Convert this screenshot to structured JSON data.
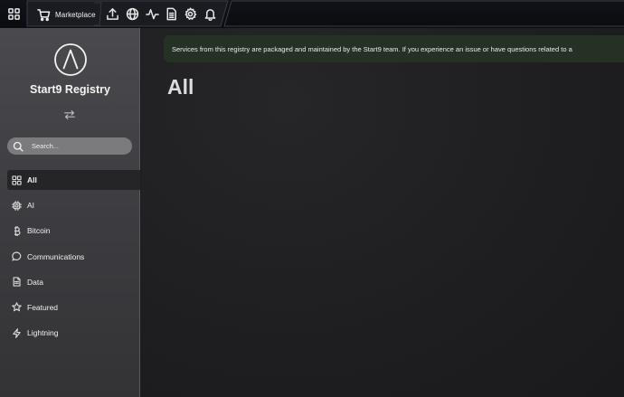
{
  "topbar": {
    "tab_label": "Marketplace",
    "icons": [
      "apps-grid-icon",
      "cart-icon",
      "upload-icon",
      "globe-icon",
      "activity-icon",
      "document-icon",
      "gear-icon",
      "bell-icon"
    ]
  },
  "sidebar": {
    "brand": "Start9 Registry",
    "search_placeholder": "Search...",
    "items": [
      {
        "label": "All",
        "icon": "grid-icon",
        "active": true
      },
      {
        "label": "AI",
        "icon": "chip-icon",
        "active": false
      },
      {
        "label": "Bitcoin",
        "icon": "bitcoin-icon",
        "active": false
      },
      {
        "label": "Communications",
        "icon": "chat-bubble-icon",
        "active": false
      },
      {
        "label": "Data",
        "icon": "document-icon",
        "active": false
      },
      {
        "label": "Featured",
        "icon": "star-icon",
        "active": false
      },
      {
        "label": "Lightning",
        "icon": "lightning-icon",
        "active": false
      }
    ]
  },
  "main": {
    "banner_text": "Services from this registry are packaged and maintained by the Start9 team. If you experience an issue or have questions related to a",
    "title": "All"
  },
  "colors": {
    "sidebar_bg": "#4a4a4e",
    "main_bg": "#1e1e20",
    "banner_bg": "#263126",
    "active_item_bg": "#252528",
    "search_bg": "#7b7b7e"
  }
}
